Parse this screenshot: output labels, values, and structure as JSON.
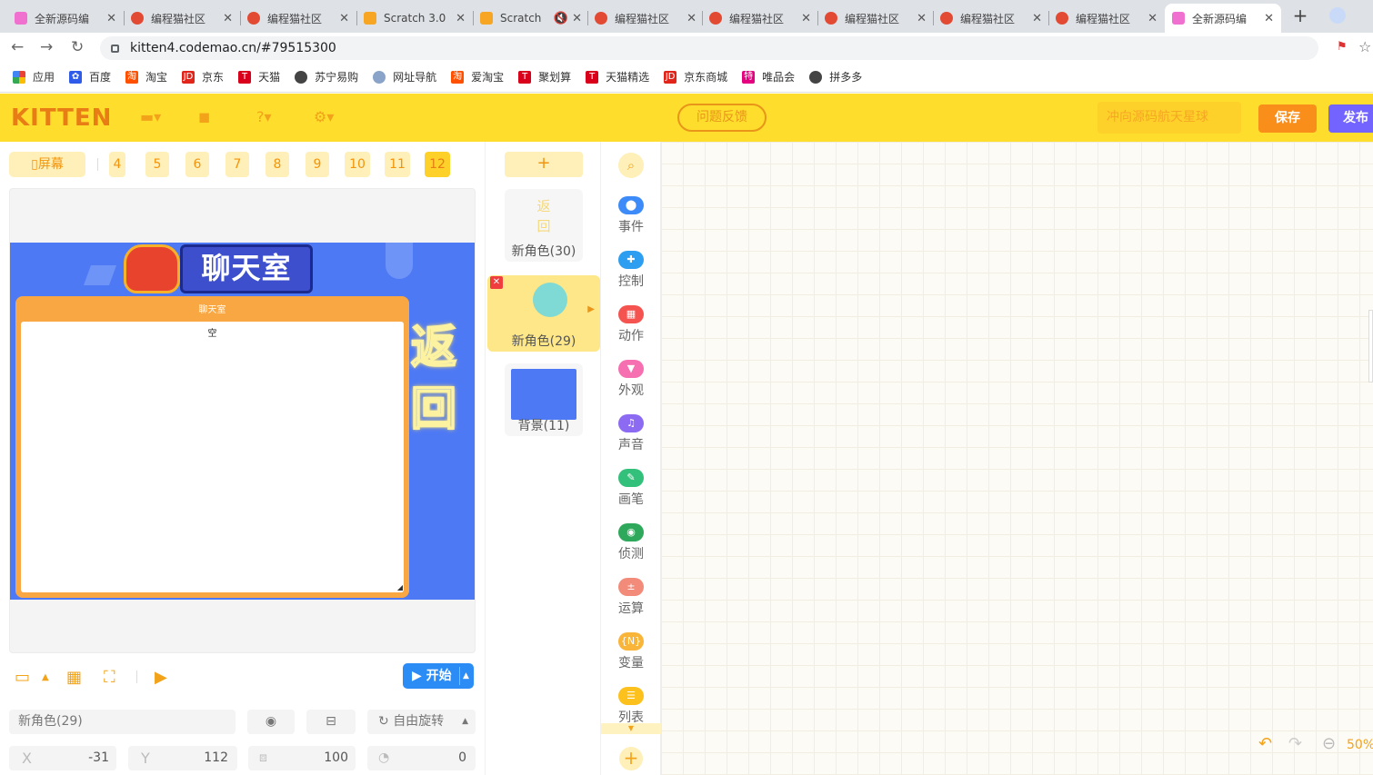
{
  "browser": {
    "tabs": [
      {
        "title": "全新源码编",
        "type": "codemao"
      },
      {
        "title": "编程猫社区",
        "type": "cat"
      },
      {
        "title": "编程猫社区",
        "type": "cat"
      },
      {
        "title": "Scratch 3.0",
        "type": "scratch"
      },
      {
        "title": "Scratch",
        "type": "scratch"
      },
      {
        "title": "编程猫社区",
        "type": "cat"
      },
      {
        "title": "编程猫社区",
        "type": "cat"
      },
      {
        "title": "编程猫社区",
        "type": "cat"
      },
      {
        "title": "编程猫社区",
        "type": "cat"
      },
      {
        "title": "编程猫社区",
        "type": "cat"
      },
      {
        "title": "全新源码编",
        "type": "codemao",
        "active": true
      }
    ],
    "url": "kitten4.codemao.cn/#79515300",
    "bookmarks": [
      "应用",
      "百度",
      "淘宝",
      "京东",
      "天猫",
      "苏宁易购",
      "网址导航",
      "爱淘宝",
      "聚划算",
      "天猫精选",
      "京东商城",
      "唯品会",
      "拼多多"
    ]
  },
  "header": {
    "logo": "KITTEN",
    "feedback": "问题反馈",
    "project_name": "冲向源码航天星球",
    "save": "保存",
    "publish": "发布"
  },
  "stage": {
    "screen_label": "屏幕",
    "screen_numbers": [
      "4",
      "5",
      "6",
      "7",
      "8",
      "9",
      "10",
      "11",
      "12"
    ],
    "active_screen": "12",
    "banner_text": "聊天室",
    "chat_title": "聊天室",
    "chat_content": "空",
    "back_text": "返回",
    "start_label": "开始"
  },
  "sprite_props": {
    "name": "新角色(29)",
    "rotation": "自由旋转",
    "x_label": "X",
    "x": "-31",
    "y_label": "Y",
    "y": "112",
    "size": "100",
    "direction": "0"
  },
  "sprites": {
    "add": "+",
    "items": [
      {
        "label": "新角色(30)",
        "thumb": "返回"
      },
      {
        "label": "新角色(29)",
        "selected": true
      },
      {
        "label": "背景(11)"
      }
    ]
  },
  "categories": [
    {
      "label": "事件",
      "color": "#3d8bf8"
    },
    {
      "label": "控制",
      "color": "#2d9ef0"
    },
    {
      "label": "动作",
      "color": "#f5534f"
    },
    {
      "label": "外观",
      "color": "#f66fb0"
    },
    {
      "label": "声音",
      "color": "#8c6af2"
    },
    {
      "label": "画笔",
      "color": "#32c07a"
    },
    {
      "label": "侦测",
      "color": "#2ea85a"
    },
    {
      "label": "运算",
      "color": "#f28b7a"
    },
    {
      "label": "变量",
      "color": "#f9b43a"
    },
    {
      "label": "列表",
      "color": "#fcc11c"
    }
  ],
  "workspace": {
    "zoom": "50%"
  }
}
